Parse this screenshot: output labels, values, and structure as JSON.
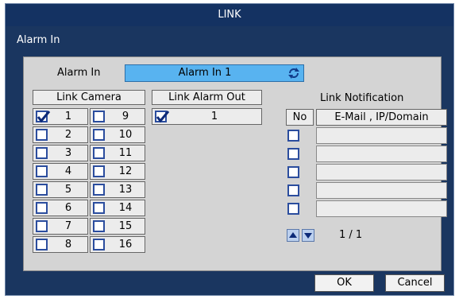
{
  "window": {
    "title": "LINK",
    "section_label": "Alarm In"
  },
  "alarm_in": {
    "label": "Alarm In",
    "selected": "Alarm In 1"
  },
  "link_camera": {
    "header": "Link Camera",
    "rows": [
      [
        {
          "num": "1",
          "checked": true
        },
        {
          "num": "9",
          "checked": false
        }
      ],
      [
        {
          "num": "2",
          "checked": false
        },
        {
          "num": "10",
          "checked": false
        }
      ],
      [
        {
          "num": "3",
          "checked": false
        },
        {
          "num": "11",
          "checked": false
        }
      ],
      [
        {
          "num": "4",
          "checked": false
        },
        {
          "num": "12",
          "checked": false
        }
      ],
      [
        {
          "num": "5",
          "checked": false
        },
        {
          "num": "13",
          "checked": false
        }
      ],
      [
        {
          "num": "6",
          "checked": false
        },
        {
          "num": "14",
          "checked": false
        }
      ],
      [
        {
          "num": "7",
          "checked": false
        },
        {
          "num": "15",
          "checked": false
        }
      ],
      [
        {
          "num": "8",
          "checked": false
        },
        {
          "num": "16",
          "checked": false
        }
      ]
    ]
  },
  "link_alarm_out": {
    "header": "Link Alarm Out",
    "items": [
      {
        "num": "1",
        "checked": true
      }
    ]
  },
  "link_notification": {
    "header": "Link Notification",
    "col_no": "No",
    "col_target": "E-Mail , IP/Domain",
    "rows": [
      {
        "checked": false,
        "value": ""
      },
      {
        "checked": false,
        "value": ""
      },
      {
        "checked": false,
        "value": ""
      },
      {
        "checked": false,
        "value": ""
      },
      {
        "checked": false,
        "value": ""
      }
    ],
    "page": "1 / 1"
  },
  "buttons": {
    "ok": "OK",
    "cancel": "Cancel"
  },
  "icons": {
    "cycle": "refresh-cycle-icon",
    "up": "arrow-up-icon",
    "down": "arrow-down-icon",
    "check": "check-icon"
  },
  "colors": {
    "window_bg": "#1a3660",
    "select_bg": "#58b3f0",
    "check_border": "#2b4d9e"
  }
}
